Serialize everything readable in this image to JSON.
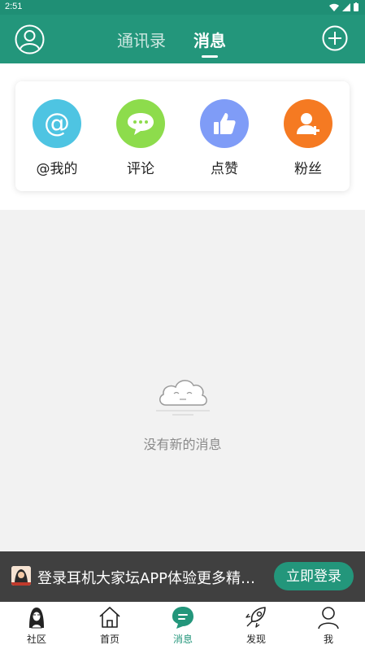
{
  "status_bar": {
    "time": "2:51"
  },
  "header": {
    "tabs": [
      {
        "label": "通讯录",
        "active": false
      },
      {
        "label": "消息",
        "active": true
      }
    ],
    "accent_color": "#23967b"
  },
  "quick_actions": [
    {
      "label": "@我的",
      "icon": "at-icon",
      "color": "#4ec4e2"
    },
    {
      "label": "评论",
      "icon": "comment-icon",
      "color": "#8ddc4c"
    },
    {
      "label": "点赞",
      "icon": "thumbs-up-icon",
      "color": "#7f9cf7"
    },
    {
      "label": "粉丝",
      "icon": "add-user-icon",
      "color": "#f57a22"
    }
  ],
  "empty_state": {
    "text": "没有新的消息"
  },
  "login_banner": {
    "text": "登录耳机大家坛APP体验更多精彩内容",
    "button": "立即登录"
  },
  "bottom_nav": [
    {
      "label": "社区",
      "icon": "community-icon",
      "active": false
    },
    {
      "label": "首页",
      "icon": "home-icon",
      "active": false
    },
    {
      "label": "消息",
      "icon": "message-icon",
      "active": true
    },
    {
      "label": "发现",
      "icon": "rocket-icon",
      "active": false
    },
    {
      "label": "我",
      "icon": "profile-icon",
      "active": false
    }
  ]
}
